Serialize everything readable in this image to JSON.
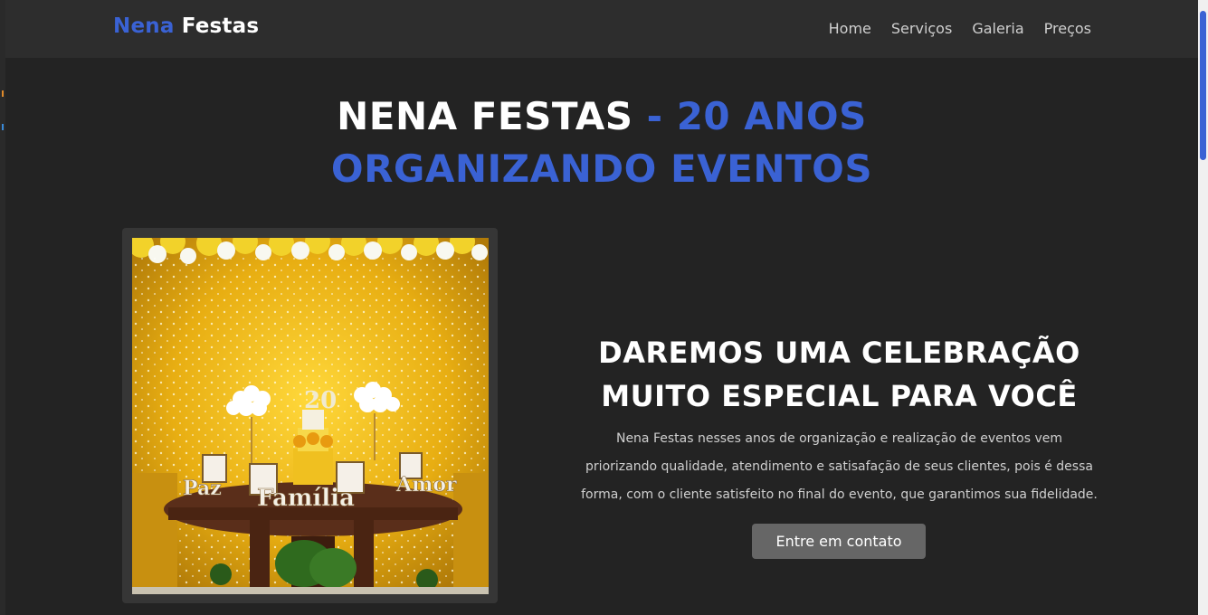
{
  "navbar": {
    "brand_part1": "Nena",
    "brand_part2": "Festas",
    "links": [
      "Home",
      "Serviços",
      "Galeria",
      "Preços"
    ]
  },
  "hero": {
    "title_white": "NENA FESTAS",
    "title_blue_line1": "- 20 ANOS",
    "title_blue_line2": "ORGANIZANDO EVENTOS"
  },
  "photo": {
    "word_left": "Paz",
    "word_center": "Família",
    "word_right": "Amor"
  },
  "content": {
    "tagline_line1": "DAREMOS UMA CELEBRAÇÃO",
    "tagline_line2": "MUITO ESPECIAL PARA VOCÊ",
    "description": "Nena Festas nesses anos de organização e realização de eventos vem priorizando qualidade, atendimento e satisafação de seus clientes, pois é dessa forma, com o cliente satisfeito no final do evento, que garantimos sua fidelidade.",
    "cta_label": "Entre em contato"
  },
  "colors": {
    "accent": "#3a62d4",
    "background": "#232323",
    "navbar": "#2d2d2d",
    "button": "#666666"
  }
}
